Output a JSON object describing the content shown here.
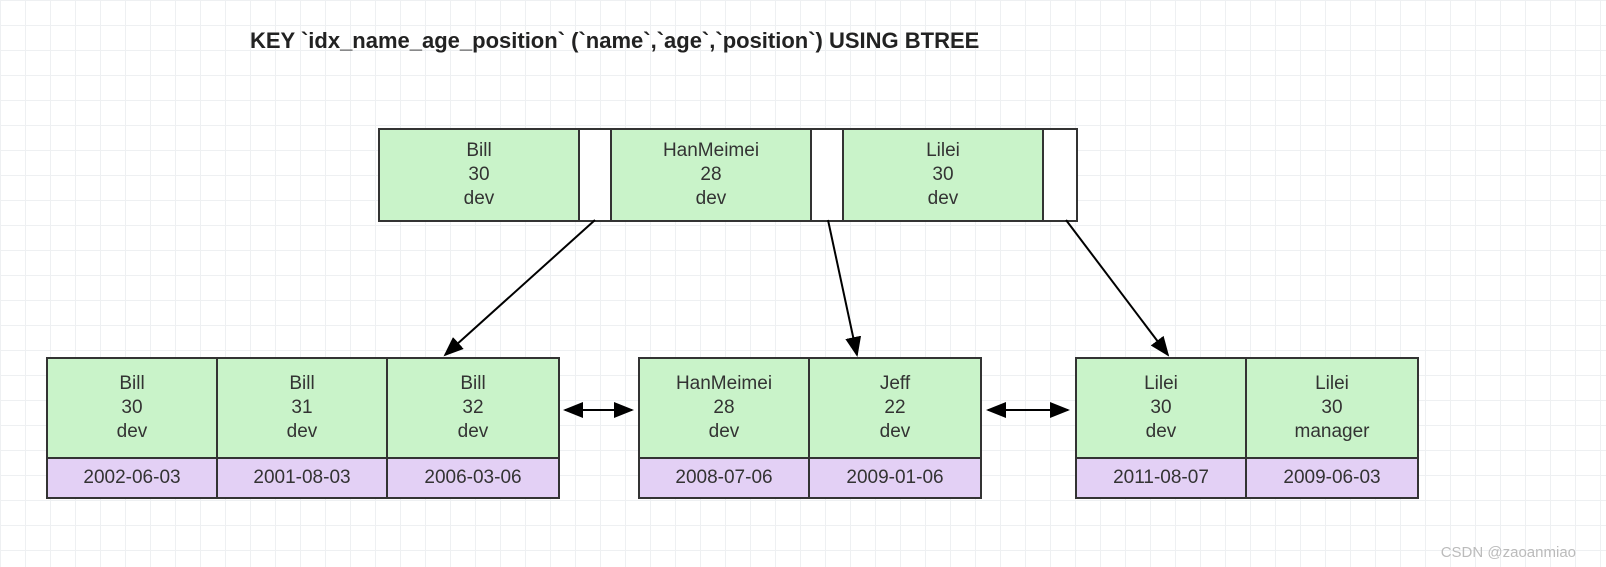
{
  "title": "KEY `idx_name_age_position` (`name`,`age`,`position`) USING BTREE",
  "root": [
    {
      "name": "Bill",
      "age": "30",
      "position": "dev"
    },
    {
      "name": "HanMeimei",
      "age": "28",
      "position": "dev"
    },
    {
      "name": "Lilei",
      "age": "30",
      "position": "dev"
    }
  ],
  "leaves": [
    [
      {
        "name": "Bill",
        "age": "30",
        "position": "dev",
        "date": "2002-06-03"
      },
      {
        "name": "Bill",
        "age": "31",
        "position": "dev",
        "date": "2001-08-03"
      },
      {
        "name": "Bill",
        "age": "32",
        "position": "dev",
        "date": "2006-03-06"
      }
    ],
    [
      {
        "name": "HanMeimei",
        "age": "28",
        "position": "dev",
        "date": "2008-07-06"
      },
      {
        "name": "Jeff",
        "age": "22",
        "position": "dev",
        "date": "2009-01-06"
      }
    ],
    [
      {
        "name": "Lilei",
        "age": "30",
        "position": "dev",
        "date": "2011-08-07"
      },
      {
        "name": "Lilei",
        "age": "30",
        "position": "manager",
        "date": "2009-06-03"
      }
    ]
  ],
  "watermark": "CSDN @zaoanmiao"
}
